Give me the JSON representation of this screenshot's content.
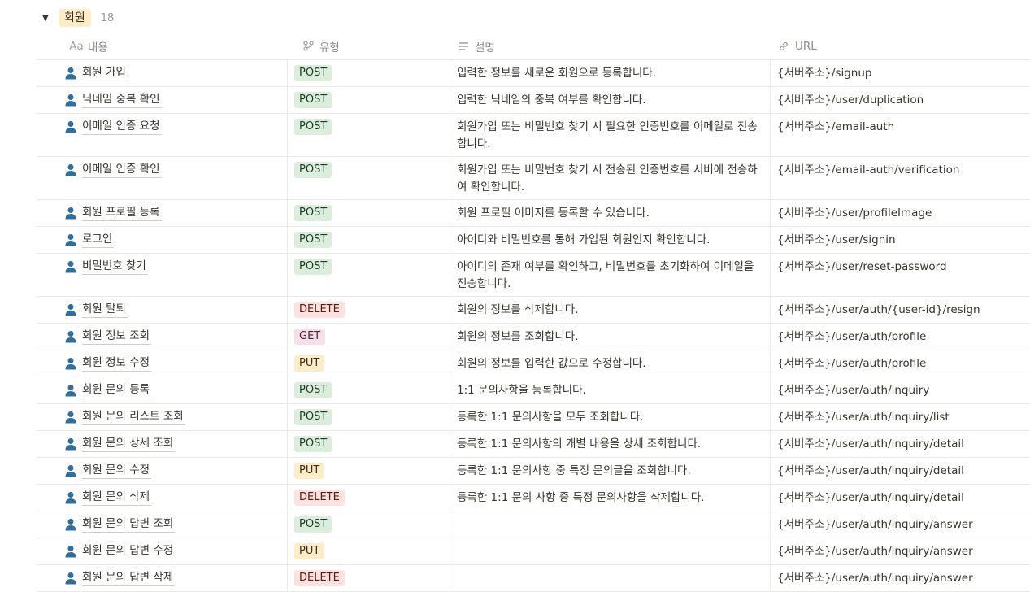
{
  "group": {
    "toggle": "▼",
    "name": "회원",
    "count": "18"
  },
  "columns": [
    {
      "icon": "text-type-icon",
      "glyph": "Aa",
      "label": "내용"
    },
    {
      "icon": "multi-select-icon",
      "glyph": "⑂",
      "label": "유형"
    },
    {
      "icon": "text-lines-icon",
      "glyph": "≡",
      "label": "설명"
    },
    {
      "icon": "link-icon",
      "glyph": "⛓",
      "label": "URL"
    }
  ],
  "colors": {
    "POST": "#dbeddb",
    "GET": "#f5e0e9",
    "PUT": "#fdecc8",
    "DELETE": "#ffe2dd",
    "person_icon": "#2e6f9e"
  },
  "rows": [
    {
      "title": "회원 가입",
      "type": "POST",
      "desc": "입력한 정보를 새로운 회원으로 등록합니다.",
      "url": "{서버주소}/signup"
    },
    {
      "title": "닉네임 중복 확인",
      "type": "POST",
      "desc": "입력한 닉네임의 중복 여부를 확인합니다.",
      "url": "{서버주소}/user/duplication"
    },
    {
      "title": "이메일 인증 요청",
      "type": "POST",
      "desc": "회원가입 또는 비밀번호 찾기 시 필요한 인증번호를 이메일로 전송합니다.",
      "url": "{서버주소}/email-auth"
    },
    {
      "title": "이메일 인증 확인",
      "type": "POST",
      "desc": "회원가입 또는 비밀번호 찾기 시 전송된 인증번호를 서버에 전송하여 확인합니다.",
      "url": "{서버주소}/email-auth/verification"
    },
    {
      "title": "회원 프로필 등록",
      "type": "POST",
      "desc": "회원 프로필 이미지를 등록할 수 있습니다.",
      "url": "{서버주소}/user/profileImage"
    },
    {
      "title": "로그인",
      "type": "POST",
      "desc": "아이디와 비밀번호를 통해 가입된 회원인지 확인합니다.",
      "url": "{서버주소}/user/signin"
    },
    {
      "title": "비밀번호 찾기",
      "type": "POST",
      "desc": "아이디의 존재 여부를 확인하고, 비밀번호를 초기화하여 이메일을 전송합니다.",
      "url": "{서버주소}/user/reset-password"
    },
    {
      "title": "회원 탈퇴",
      "type": "DELETE",
      "desc": "회원의 정보를 삭제합니다.",
      "url": "{서버주소}/user/auth/{user-id}/resign"
    },
    {
      "title": "회원 정보 조회",
      "type": "GET",
      "desc": "회원의 정보를 조회합니다.",
      "url": "{서버주소}/user/auth/profile"
    },
    {
      "title": "회원 정보 수정",
      "type": "PUT",
      "desc": "회원의 정보를 입력한 값으로 수정합니다.",
      "url": "{서버주소}/user/auth/profile"
    },
    {
      "title": "회원 문의 등록",
      "type": "POST",
      "desc": "1:1 문의사항을 등록합니다.",
      "url": "{서버주소}/user/auth/inquiry"
    },
    {
      "title": "회원 문의 리스트 조회",
      "type": "POST",
      "desc": "등록한 1:1 문의사항을 모두 조회합니다.",
      "url": "{서버주소}/user/auth/inquiry/list"
    },
    {
      "title": "회원 문의 상세 조회",
      "type": "POST",
      "desc": "등록한 1:1 문의사항의 개별 내용을 상세 조회합니다.",
      "url": "{서버주소}/user/auth/inquiry/detail"
    },
    {
      "title": "회원 문의 수정",
      "type": "PUT",
      "desc": "등록한 1:1 문의사항 중 특정 문의글을 조회합니다.",
      "url": "{서버주소}/user/auth/inquiry/detail"
    },
    {
      "title": "회원 문의 삭제",
      "type": "DELETE",
      "desc": "등록한 1:1 문의 사항 중 특정 문의사항을 삭제합니다.",
      "url": "{서버주소}/user/auth/inquiry/detail"
    },
    {
      "title": "회원 문의 답변 조회",
      "type": "POST",
      "desc": "",
      "url": "{서버주소}/user/auth/inquiry/answer"
    },
    {
      "title": "회원 문의 답변 수정",
      "type": "PUT",
      "desc": "",
      "url": "{서버주소}/user/auth/inquiry/answer"
    },
    {
      "title": "회원 문의 답변 삭제",
      "type": "DELETE",
      "desc": "",
      "url": "{서버주소}/user/auth/inquiry/answer"
    }
  ]
}
